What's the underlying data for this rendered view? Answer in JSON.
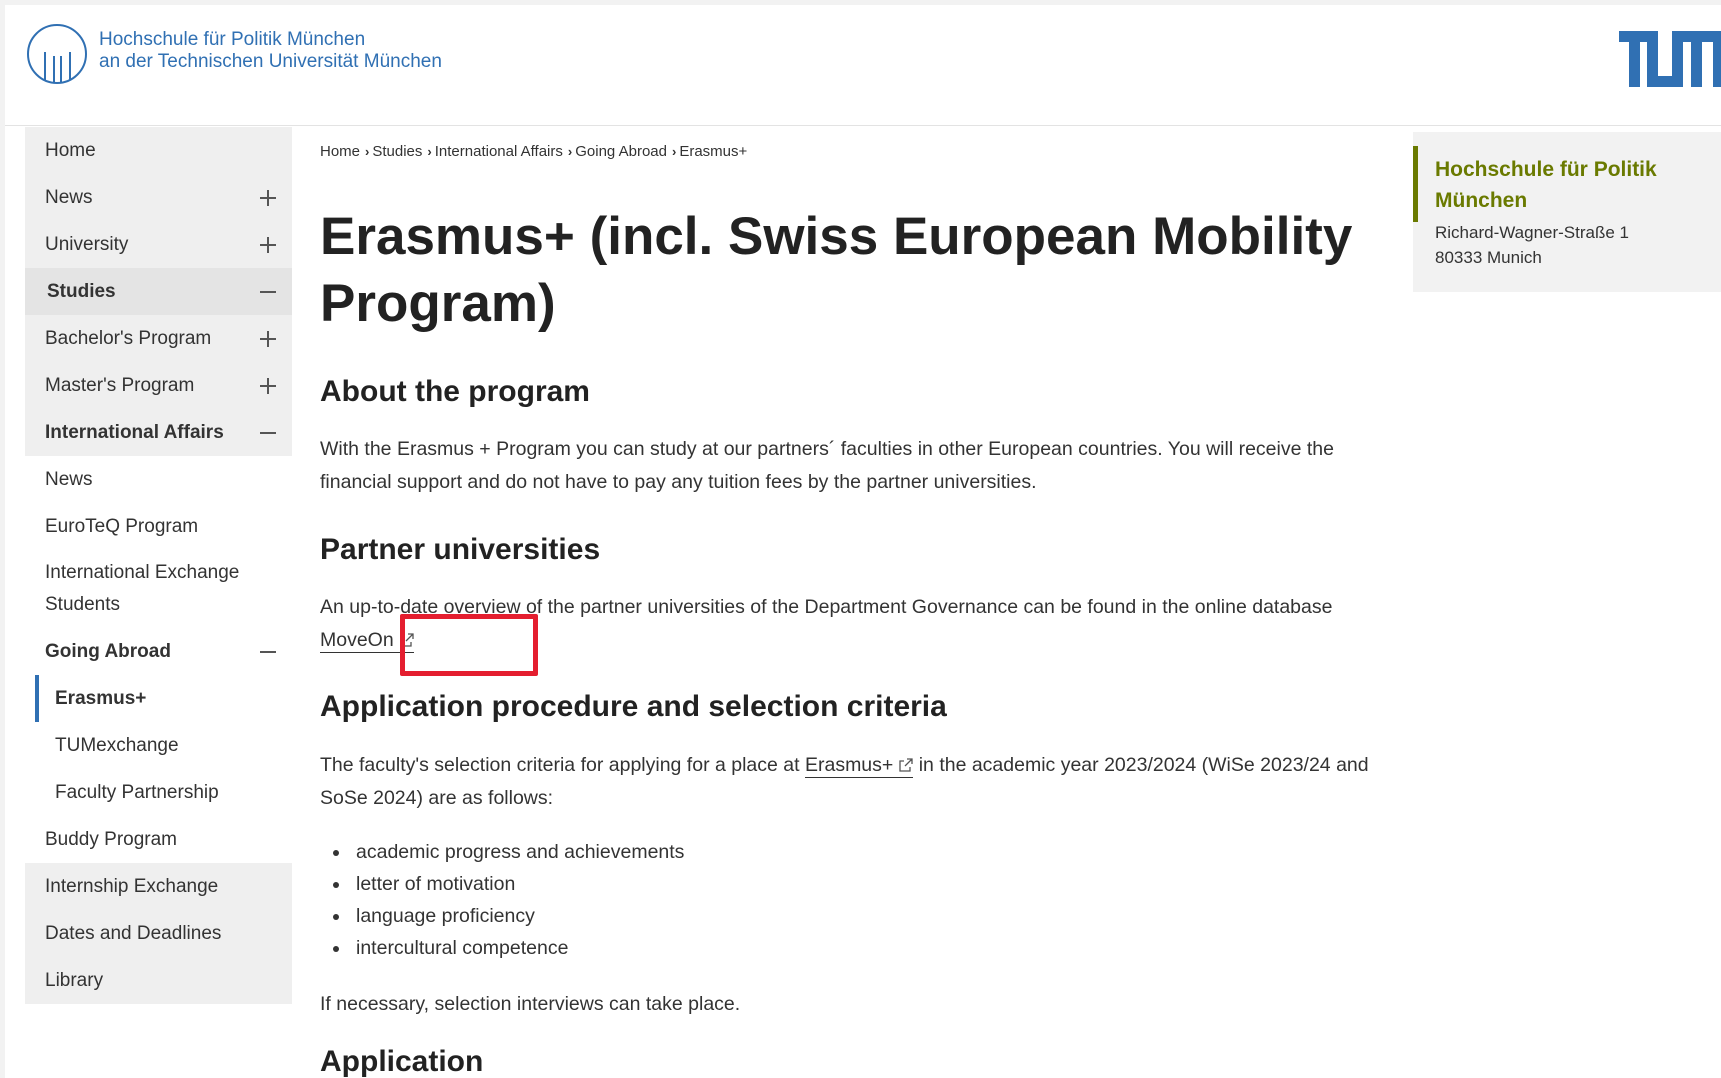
{
  "header": {
    "institution_line1": "Hochschule für Politik München",
    "institution_line2": "an der Technischen Universität München",
    "tum_logo": "tum-logo"
  },
  "sidebar": {
    "items": [
      {
        "label": "Home",
        "toggle": "none"
      },
      {
        "label": "News",
        "toggle": "plus"
      },
      {
        "label": "University",
        "toggle": "plus"
      },
      {
        "label": "Studies",
        "toggle": "minus"
      },
      {
        "label": "Bachelor's Program",
        "toggle": "plus"
      },
      {
        "label": "Master's Program",
        "toggle": "plus"
      },
      {
        "label": "International Affairs",
        "toggle": "minus"
      },
      {
        "label": "News",
        "toggle": "none"
      },
      {
        "label": "EuroTeQ Program",
        "toggle": "none"
      },
      {
        "label": "International Exchange Students",
        "toggle": "none"
      },
      {
        "label": "Going Abroad",
        "toggle": "minus"
      },
      {
        "label": "Erasmus+",
        "toggle": "none",
        "active": true
      },
      {
        "label": "TUMexchange",
        "toggle": "none"
      },
      {
        "label": "Faculty Partnership",
        "toggle": "none"
      },
      {
        "label": "Buddy Program",
        "toggle": "none"
      },
      {
        "label": "Internship Exchange",
        "toggle": "none"
      },
      {
        "label": "Dates and Deadlines",
        "toggle": "none"
      },
      {
        "label": "Library",
        "toggle": "none"
      }
    ]
  },
  "breadcrumb": [
    "Home",
    "Studies",
    "International Affairs",
    "Going Abroad",
    "Erasmus+"
  ],
  "main": {
    "title": "Erasmus+ (incl. Swiss European Mobility Program)",
    "about_heading": "About the program",
    "about_text": "With the Erasmus + Program you can study at our partners´ faculties in other European countries. You will receive the financial support and do not have to pay any tuition fees by the partner universities.",
    "partners_heading": "Partner universities",
    "partners_text": "An up-to-date overview of the partner universities of the Department Governance can be found in the online database",
    "moveon_link": "MoveOn",
    "application_heading": "Application procedure and selection criteria",
    "criteria_text_before": "The faculty's selection criteria for applying for a place at",
    "erasmus_link": "Erasmus+",
    "criteria_text_after": "in the academic year 2023/2024 (WiSe 2023/24 and SoSe 2024) are as follows:",
    "criteria": [
      "academic progress and achievements",
      "letter of motivation",
      "language proficiency",
      "intercultural competence"
    ],
    "interviews_text": "If necessary, selection interviews can take place.",
    "next_heading": "Application"
  },
  "infobox": {
    "org": "Hochschule für Politik München",
    "street": "Richard-Wagner-Straße 1",
    "city": "80333 Munich"
  },
  "colors": {
    "brand_blue": "#3070b3",
    "accent_olive": "#6a7a00",
    "highlight_red": "#e41e2f",
    "nav_gray": "#efefef"
  }
}
